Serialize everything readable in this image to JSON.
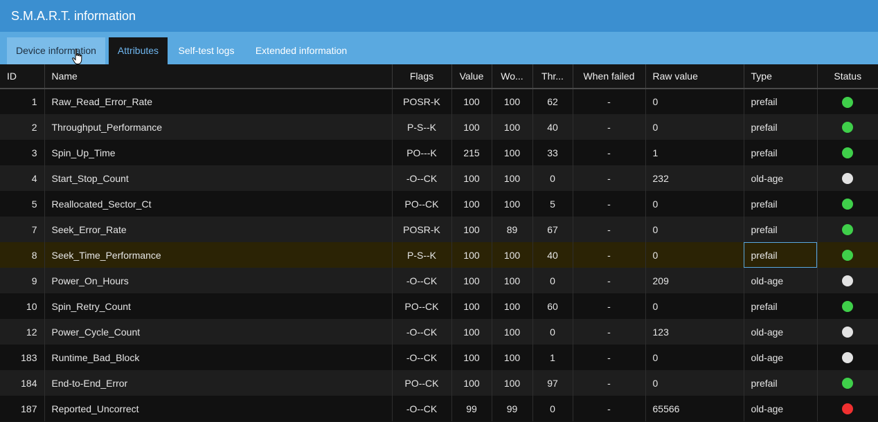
{
  "window": {
    "title": "S.M.A.R.T. information"
  },
  "tabs": [
    {
      "label": "Device information"
    },
    {
      "label": "Attributes"
    },
    {
      "label": "Self-test logs"
    },
    {
      "label": "Extended information"
    }
  ],
  "table": {
    "columns": [
      "ID",
      "Name",
      "Flags",
      "Value",
      "Wo...",
      "Thr...",
      "When failed",
      "Raw value",
      "Type",
      "Status"
    ],
    "rows": [
      {
        "id": "1",
        "name": "Raw_Read_Error_Rate",
        "flags": "POSR-K",
        "value": "100",
        "worst": "100",
        "thresh": "62",
        "when_failed": "-",
        "raw": "0",
        "type": "prefail",
        "status": "good"
      },
      {
        "id": "2",
        "name": "Throughput_Performance",
        "flags": "P-S--K",
        "value": "100",
        "worst": "100",
        "thresh": "40",
        "when_failed": "-",
        "raw": "0",
        "type": "prefail",
        "status": "good"
      },
      {
        "id": "3",
        "name": "Spin_Up_Time",
        "flags": "PO---K",
        "value": "215",
        "worst": "100",
        "thresh": "33",
        "when_failed": "-",
        "raw": "1",
        "type": "prefail",
        "status": "good"
      },
      {
        "id": "4",
        "name": "Start_Stop_Count",
        "flags": "-O--CK",
        "value": "100",
        "worst": "100",
        "thresh": "0",
        "when_failed": "-",
        "raw": "232",
        "type": "old-age",
        "status": "neutral"
      },
      {
        "id": "5",
        "name": "Reallocated_Sector_Ct",
        "flags": "PO--CK",
        "value": "100",
        "worst": "100",
        "thresh": "5",
        "when_failed": "-",
        "raw": "0",
        "type": "prefail",
        "status": "good"
      },
      {
        "id": "7",
        "name": "Seek_Error_Rate",
        "flags": "POSR-K",
        "value": "100",
        "worst": "89",
        "thresh": "67",
        "when_failed": "-",
        "raw": "0",
        "type": "prefail",
        "status": "good"
      },
      {
        "id": "8",
        "name": "Seek_Time_Performance",
        "flags": "P-S--K",
        "value": "100",
        "worst": "100",
        "thresh": "40",
        "when_failed": "-",
        "raw": "0",
        "type": "prefail",
        "status": "good"
      },
      {
        "id": "9",
        "name": "Power_On_Hours",
        "flags": "-O--CK",
        "value": "100",
        "worst": "100",
        "thresh": "0",
        "when_failed": "-",
        "raw": "209",
        "type": "old-age",
        "status": "neutral"
      },
      {
        "id": "10",
        "name": "Spin_Retry_Count",
        "flags": "PO--CK",
        "value": "100",
        "worst": "100",
        "thresh": "60",
        "when_failed": "-",
        "raw": "0",
        "type": "prefail",
        "status": "good"
      },
      {
        "id": "12",
        "name": "Power_Cycle_Count",
        "flags": "-O--CK",
        "value": "100",
        "worst": "100",
        "thresh": "0",
        "when_failed": "-",
        "raw": "123",
        "type": "old-age",
        "status": "neutral"
      },
      {
        "id": "183",
        "name": "Runtime_Bad_Block",
        "flags": "-O--CK",
        "value": "100",
        "worst": "100",
        "thresh": "1",
        "when_failed": "-",
        "raw": "0",
        "type": "old-age",
        "status": "neutral"
      },
      {
        "id": "184",
        "name": "End-to-End_Error",
        "flags": "PO--CK",
        "value": "100",
        "worst": "100",
        "thresh": "97",
        "when_failed": "-",
        "raw": "0",
        "type": "prefail",
        "status": "good"
      },
      {
        "id": "187",
        "name": "Reported_Uncorrect",
        "flags": "-O--CK",
        "value": "99",
        "worst": "99",
        "thresh": "0",
        "when_failed": "-",
        "raw": "65566",
        "type": "old-age",
        "status": "bad"
      }
    ]
  },
  "colors": {
    "good": "#3fcf4a",
    "neutral": "#e2e2e2",
    "bad": "#f03030",
    "accent": "#3b8fd0"
  },
  "cursor": {
    "icon": "hand-pointer-icon"
  }
}
